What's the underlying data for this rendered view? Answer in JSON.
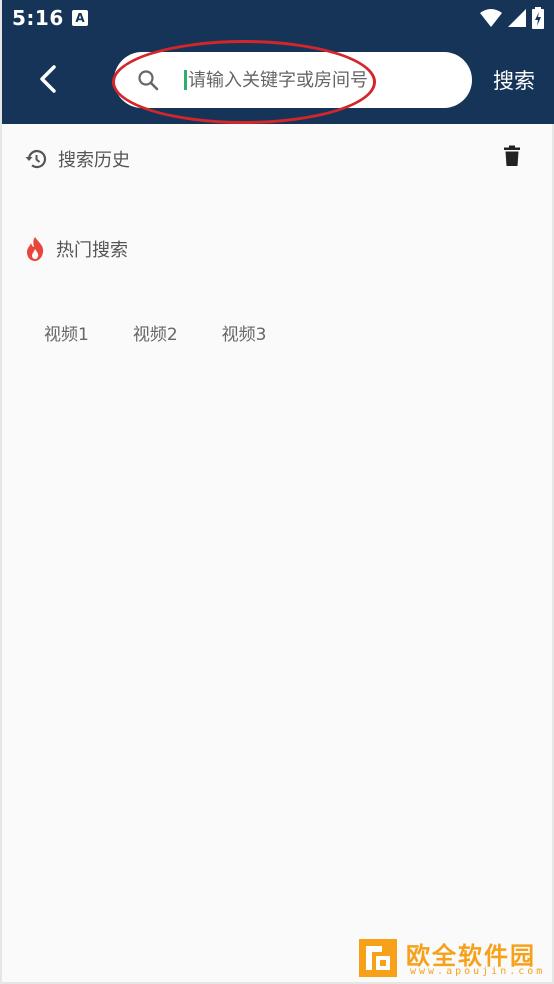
{
  "status_bar": {
    "time": "5:16",
    "notification_icon_letter": "A"
  },
  "header": {
    "search": {
      "placeholder": "请输入关键字或房间号",
      "value": ""
    },
    "submit_label": "搜索"
  },
  "history": {
    "title": "搜索历史"
  },
  "hot": {
    "title": "热门搜索",
    "tags": [
      "视频1",
      "视频2",
      "视频3"
    ]
  },
  "watermark": {
    "brand": "欧全软件园",
    "url": "www.apoujin.com"
  },
  "colors": {
    "header_bg": "#163458",
    "hot_icon": "#e8453c",
    "annotation": "#d3262b",
    "watermark": "#f7a11a"
  },
  "icons": [
    "back-arrow-icon",
    "search-icon",
    "history-icon",
    "trash-icon",
    "fire-icon",
    "wifi-icon",
    "signal-icon",
    "battery-icon"
  ]
}
